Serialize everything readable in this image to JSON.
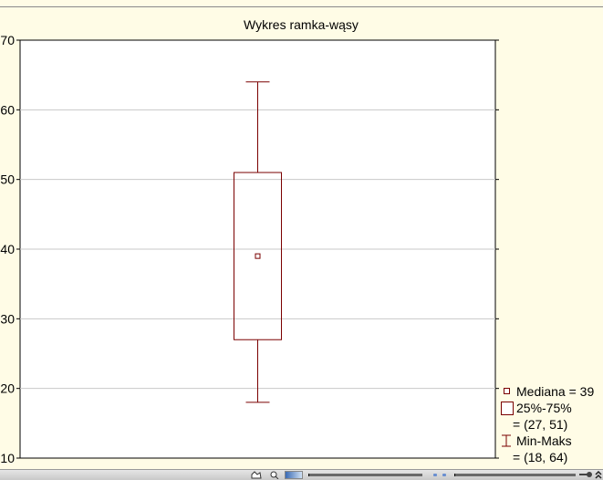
{
  "chart_data": {
    "type": "boxplot",
    "title": "Wykres ramka-wąsy",
    "xlabel": "",
    "ylabel": "",
    "ylim": [
      10,
      70
    ],
    "yticks": [
      "10",
      "20",
      "30",
      "40",
      "50",
      "60",
      "70"
    ],
    "grid": true,
    "series": [
      {
        "median": 39,
        "q1": 27,
        "q3": 51,
        "min": 18,
        "max": 64
      }
    ],
    "legend": {
      "placement": "bottom-right",
      "median_label": "Mediana = 39",
      "box_label": "25%-75%",
      "box_values": "= (27, 51)",
      "whisker_label": "Min-Maks",
      "whisker_values": "= (18, 64)"
    }
  },
  "colors": {
    "background": "#fffce6",
    "plot_area": "#ffffff",
    "box": "#7a0000",
    "grid": "#c8c8c8"
  },
  "statusbar": {
    "icons": [
      "hand-icon",
      "zoom-icon",
      "color-swatch-icon",
      "slider",
      "key-icon",
      "double-chevron-icon"
    ]
  }
}
